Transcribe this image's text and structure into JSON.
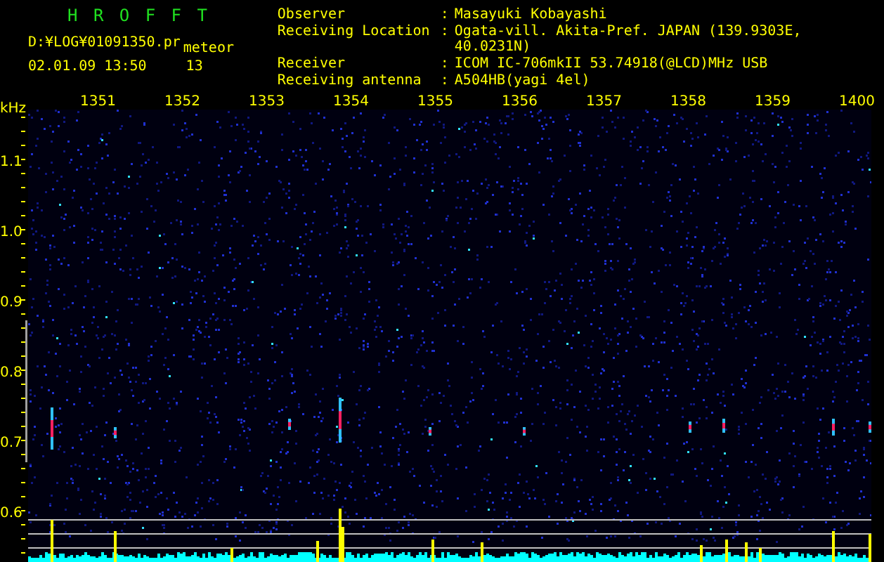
{
  "app_title": "H R O F F T",
  "file_path": "D:¥LOG¥01091350.pr",
  "mode": "meteor",
  "timestamp": "02.01.09 13:50",
  "count": "13",
  "info": [
    {
      "label": "Observer",
      "colon": ":",
      "value": "Masayuki Kobayashi"
    },
    {
      "label": "Receiving Location",
      "colon": ":",
      "value": "Ogata-vill. Akita-Pref. JAPAN (139.9303E, 40.0231N)"
    },
    {
      "label": "Receiver",
      "colon": ":",
      "value": "ICOM IC-706mkII 53.74918(@LCD)MHz USB"
    },
    {
      "label": "Receiving antenna",
      "colon": ":",
      "value": "A504HB(yagi 4el)"
    }
  ],
  "y_axis": {
    "unit": "kHz",
    "ticks": [
      "1.1",
      "1.0",
      "0.9",
      "0.8",
      "0.7",
      "0.6"
    ]
  },
  "x_ticks": [
    "1351",
    "1352",
    "1353",
    "1354",
    "1355",
    "1356",
    "1357",
    "1358",
    "1359",
    "1400"
  ]
}
